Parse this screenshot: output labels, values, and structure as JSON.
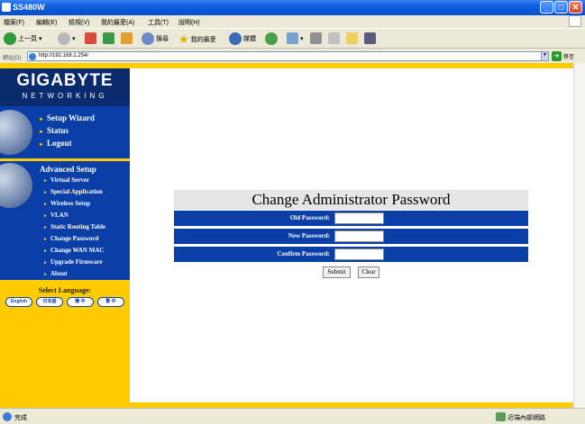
{
  "window": {
    "title": "SS480W"
  },
  "menu": [
    "檔案(F)",
    "編輯(E)",
    "檢視(V)",
    "我的最愛(A)",
    "工具(T)",
    "說明(H)"
  ],
  "toolbar": {
    "back": "上一頁",
    "search": "搜尋",
    "favorites": "我的最愛",
    "media": "媒體"
  },
  "address": {
    "label": "網址(D)",
    "url": "http://192.168.1.254/",
    "go": "移至"
  },
  "brand": {
    "name": "GIGABYTE",
    "sub": "NETWORKING"
  },
  "nav": {
    "main": [
      "Setup Wizard",
      "Status",
      "Logout"
    ],
    "advanced_title": "Advanced Setup",
    "advanced": [
      "Virtual Server",
      "Special Application",
      "Wireless Setup",
      "VLAN",
      "Static Routing Table",
      "Change Password",
      "Change WAN MAC",
      "Upgrade Firmware",
      "About"
    ]
  },
  "language": {
    "title": "Select Language:",
    "options": [
      "English",
      "日本語",
      "簡 中",
      "繁 中"
    ]
  },
  "form": {
    "title": "Change Administrator Password",
    "fields": [
      {
        "label": "Old Password:",
        "value": ""
      },
      {
        "label": "New Password:",
        "value": ""
      },
      {
        "label": "Confirm Password:",
        "value": ""
      }
    ],
    "submit": "Submit",
    "clear": "Clear"
  },
  "status": {
    "text": "完成",
    "zone": "近端內部網路"
  },
  "colors": {
    "sidebar_blue": "#0a3fa8",
    "accent_yellow": "#ffcc00",
    "logo_navy": "#0a2a6e"
  }
}
